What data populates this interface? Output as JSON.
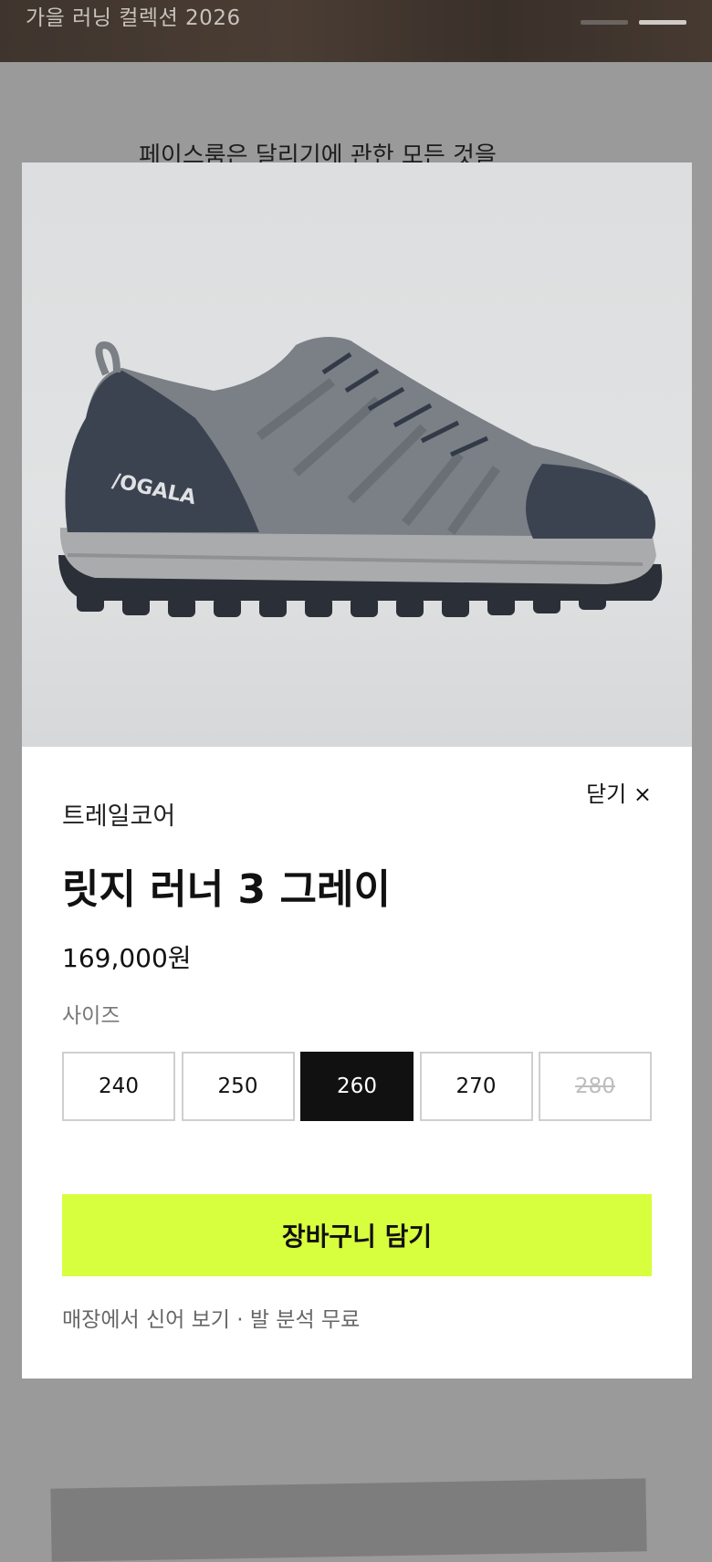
{
  "background": {
    "hero_title": "가을 러닝 컬렉션 2026",
    "intro_text": "페이스룸은 달리기에 관한 모든 것을"
  },
  "modal": {
    "close_label": "닫기 ×",
    "brand": "트레일코어",
    "product_name": "릿지 러너 3 그레이",
    "price": "169,000원",
    "size_label": "사이즈",
    "sizes": [
      {
        "label": "240",
        "state": "available"
      },
      {
        "label": "250",
        "state": "available"
      },
      {
        "label": "260",
        "state": "selected"
      },
      {
        "label": "270",
        "state": "available"
      },
      {
        "label": "280",
        "state": "sold-out"
      }
    ],
    "cart_button": "장바구니 담기",
    "footnote": "매장에서 신어 보기 · 발 분석 무료"
  },
  "colors": {
    "accent": "#d8ff3e",
    "selected_bg": "#111111",
    "overlay": "#9a9a9a"
  }
}
